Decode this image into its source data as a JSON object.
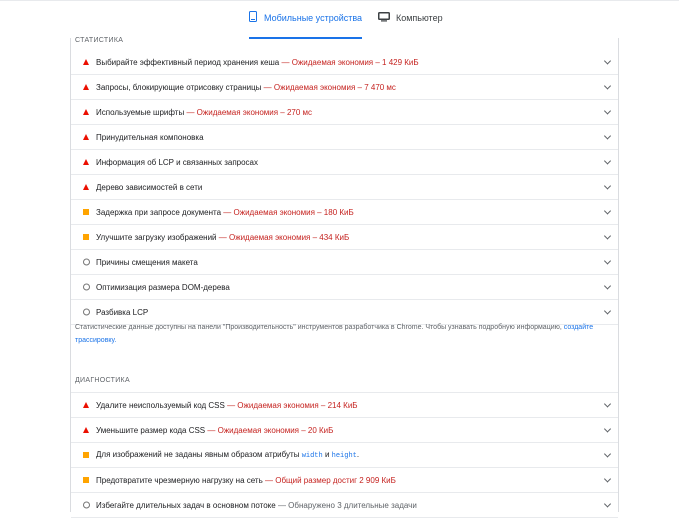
{
  "tabs": {
    "mobile": "Мобильные устройства",
    "desktop": "Компьютер"
  },
  "stats_heading": "СТАТИСТИКА",
  "stats_items": [
    {
      "status": "fail",
      "title": "Выбирайте эффективный период хранения кеша",
      "detail": "— Ожидаемая экономия – 1 429 КиБ"
    },
    {
      "status": "fail",
      "title": "Запросы, блокирующие отрисовку страницы",
      "detail": "— Ожидаемая экономия – 7 470 мс"
    },
    {
      "status": "fail",
      "title": "Используемые шрифты",
      "detail": "— Ожидаемая экономия – 270 мс"
    },
    {
      "status": "fail",
      "title": "Принудительная компоновка",
      "detail": ""
    },
    {
      "status": "fail",
      "title": "Информация об LCP и связанных запросах",
      "detail": ""
    },
    {
      "status": "fail",
      "title": "Дерево зависимостей в сети",
      "detail": ""
    },
    {
      "status": "average",
      "title": "Задержка при запросе документа",
      "detail": "— Ожидаемая экономия – 180 КиБ"
    },
    {
      "status": "average",
      "title": "Улучшите загрузку изображений",
      "detail": "— Ожидаемая экономия – 434 КиБ"
    },
    {
      "status": "info",
      "title": "Причины смещения макета",
      "detail": ""
    },
    {
      "status": "info",
      "title": "Оптимизация размера DOM-дерева",
      "detail": ""
    },
    {
      "status": "info",
      "title": "Разбивка LCP",
      "detail": ""
    }
  ],
  "note": {
    "text": "Статистические данные доступны на панели \"Производительность\" инструментов разработчика в Chrome. Чтобы узнавать подробную информацию,",
    "link": "создайте трассировку."
  },
  "diag_heading": "ДИАГНОСТИКА",
  "diag_items": [
    {
      "status": "fail",
      "title": "Удалите неиспользуемый код CSS",
      "detail": "— Ожидаемая экономия – 214 КиБ",
      "kind": "savings"
    },
    {
      "status": "fail",
      "title": "Уменьшите размер кода CSS",
      "detail": "— Ожидаемая экономия – 20 КиБ",
      "kind": "savings"
    },
    {
      "status": "average",
      "title": "Для изображений не заданы явным образом атрибуты",
      "code1": "width",
      "mid": "и",
      "code2": "height",
      "end": ".",
      "kind": "code"
    },
    {
      "status": "average",
      "title": "Предотвратите чрезмерную нагрузку на сеть",
      "detail": "— Общий размер достиг 2 909 КиБ",
      "kind": "savings"
    },
    {
      "status": "info",
      "title": "Избегайте длительных задач в основном потоке",
      "detail": "— Обнаружено 3 длительные задачи",
      "kind": "info"
    }
  ],
  "colors": {
    "accent": "#1a73e8",
    "fail": "#eb0f00",
    "average": "#ffa400",
    "savings_text": "#c5221f"
  }
}
